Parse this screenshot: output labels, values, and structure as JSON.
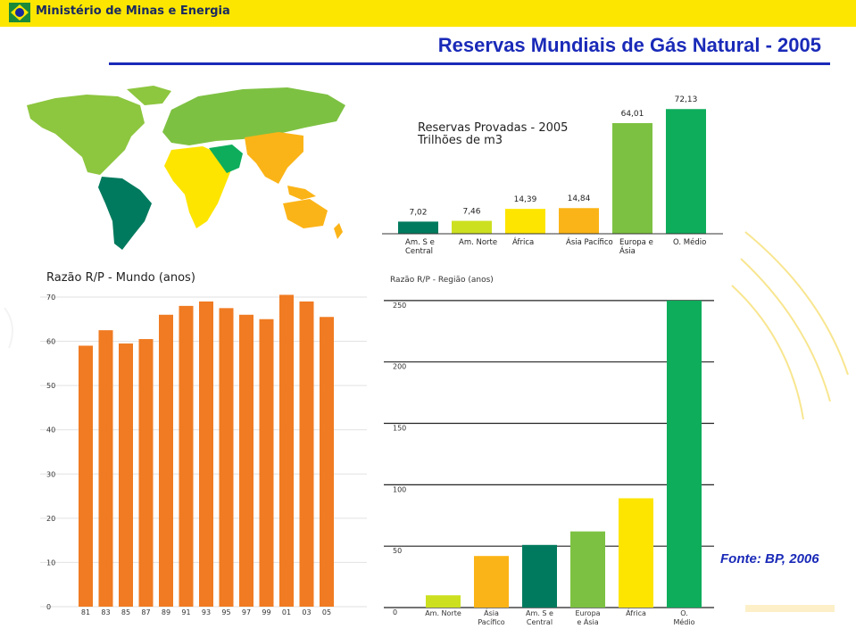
{
  "header": {
    "ministry": "Ministério de Minas e Energia",
    "slide_title": "Reservas Mundiais de Gás Natural - 2005",
    "source": "Fonte: BP, 2006"
  },
  "colors": {
    "topbar": "#fce600",
    "title": "#1a2ab8",
    "orange_bar": "#f07b22",
    "dark_green": "#007a5e",
    "lime": "#cde020",
    "yellow": "#fde500",
    "gold": "#fbb417",
    "mid_green": "#7dc142",
    "green": "#0ead5c"
  },
  "map_icon": "world-map-by-region",
  "chart_data": [
    {
      "type": "bar",
      "title": "Reservas Provadas - 2005",
      "subtitle": "Trilhões de m3",
      "categories": [
        "Am. S e Central",
        "Am. Norte",
        "África",
        "Ásia Pacífico",
        "Europa e Ásia",
        "O. Médio"
      ],
      "values": [
        7.02,
        7.46,
        14.39,
        14.84,
        64.01,
        72.13
      ],
      "value_labels": [
        "7,02",
        "7,46",
        "14,39",
        "14,84",
        "64,01",
        "72,13"
      ],
      "colors": [
        "#007a5e",
        "#cde020",
        "#fde500",
        "#fbb417",
        "#7dc142",
        "#0ead5c"
      ],
      "ylim": [
        0,
        80
      ]
    },
    {
      "type": "bar",
      "title": "Razão R/P - Mundo (anos)",
      "categories": [
        "81",
        "83",
        "85",
        "87",
        "89",
        "91",
        "93",
        "95",
        "97",
        "99",
        "01",
        "03",
        "05"
      ],
      "values": [
        59,
        62.5,
        59.5,
        60.5,
        66,
        68,
        69,
        67.5,
        66,
        65,
        70.5,
        69,
        65.5
      ],
      "yticks": [
        0,
        10,
        20,
        30,
        40,
        50,
        60,
        70
      ],
      "ylim": [
        0,
        71
      ],
      "grid": true
    },
    {
      "type": "bar",
      "title": "Razão R/P - Região (anos)",
      "categories": [
        "Am. Norte",
        "Ásia Pacífico",
        "Am. S e Central",
        "Europa e Ásia",
        "África",
        "O. Médio"
      ],
      "values": [
        10,
        42,
        51,
        62,
        89,
        250
      ],
      "colors": [
        "#cde020",
        "#fbb417",
        "#007a5e",
        "#7dc142",
        "#fde500",
        "#0ead5c"
      ],
      "yticks": [
        0,
        50,
        100,
        150,
        200,
        250
      ],
      "ylim": [
        0,
        255
      ],
      "grid": true
    }
  ]
}
